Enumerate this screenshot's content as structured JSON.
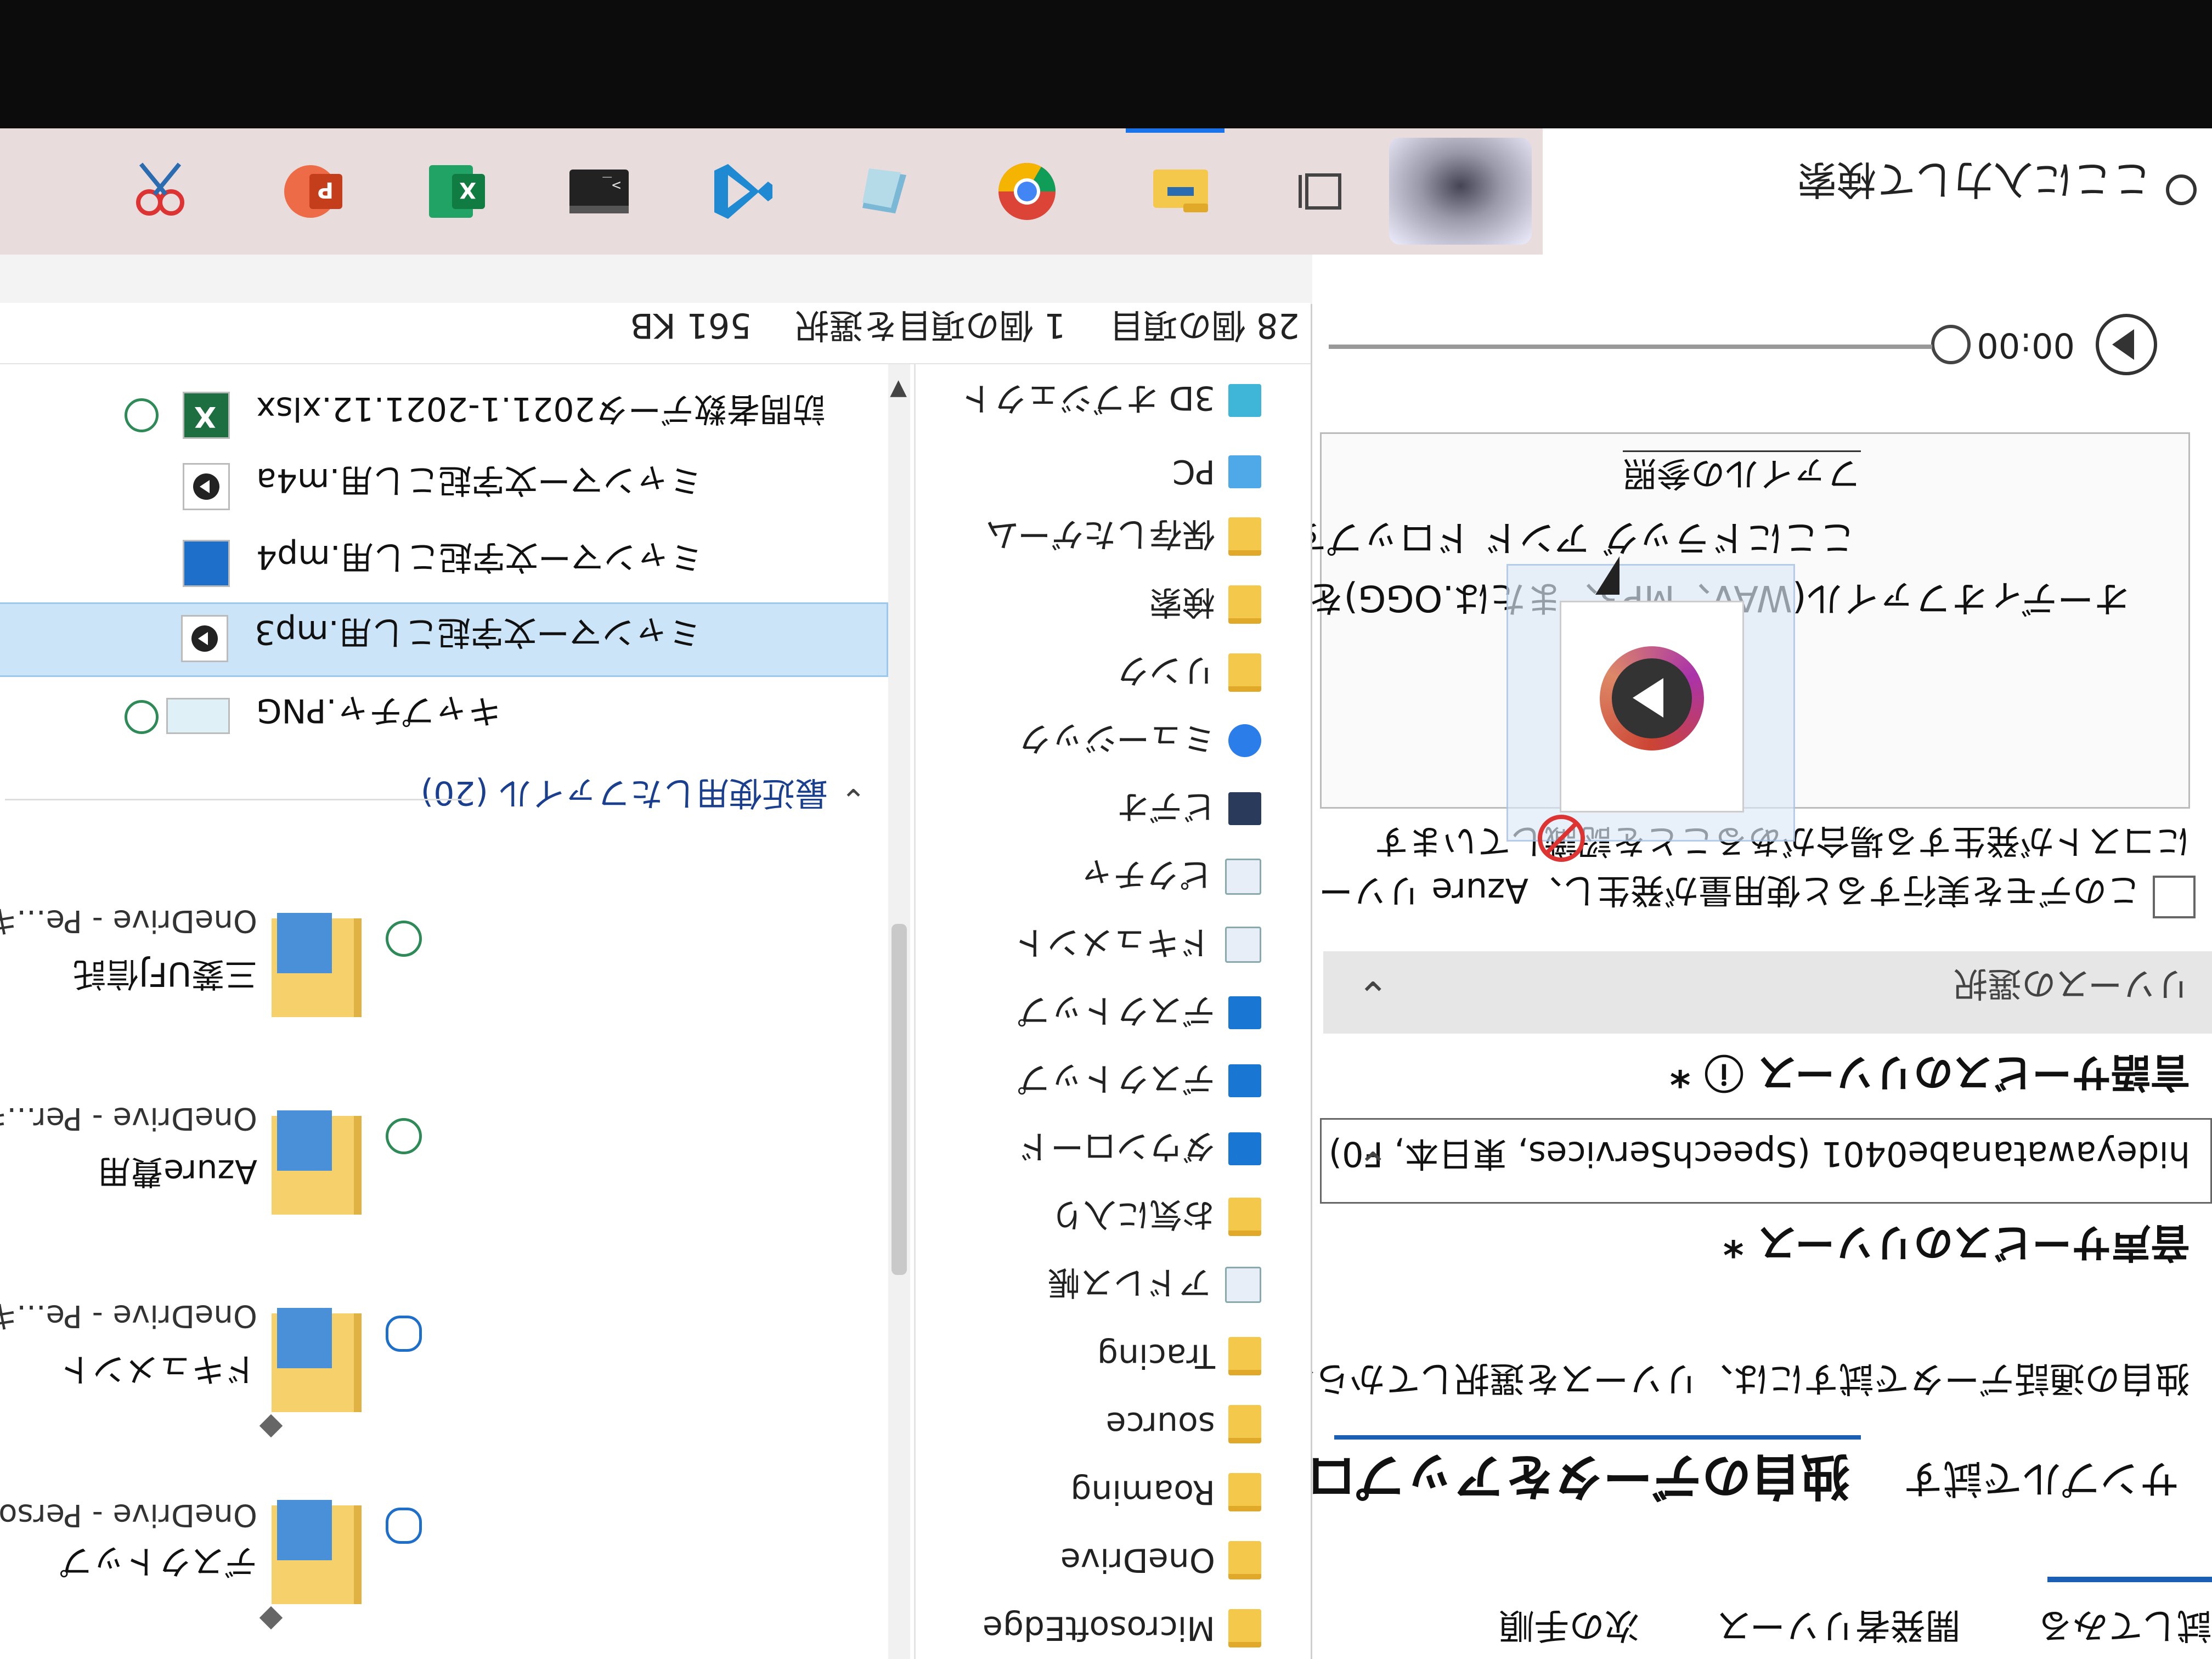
{
  "taskbar": {
    "search_placeholder": "ここに入力して検索",
    "apps": [
      "task-view",
      "file-explorer",
      "chrome",
      "files",
      "vscode",
      "terminal",
      "excel",
      "powerpoint",
      "paint"
    ]
  },
  "webpage": {
    "tabs": [
      "試してみる",
      "開発者リソース",
      "次の手順"
    ],
    "heading": "独自のデータをアップロード",
    "heading_sub": "サンプルで試す",
    "intro": "独自の通話データで試すには、リソースを選択してから、",
    "speech_label": "音声サービスのリソース *",
    "speech_value": "hideyawatanabe0401 (SpeechServices, 東日本, F0)",
    "translator_label": "言語サービスのリソース ⓘ *",
    "resource_placeholder": "リソースの選択",
    "consent_text": "このデモを実行すると使用量が発生し、Azure リソー",
    "consent_text_2": "にコストが発生する場合があることを認識しています",
    "dropzone_line1": "オーディオファイル(WAV、MP3、または.OGG)を",
    "dropzone_line2": "ここにドラッグ アンド ドロップするか、",
    "dropzone_browse": "ファイルの参照",
    "player_time": "00:00"
  },
  "explorer": {
    "status": {
      "item_count": "28 個の項目",
      "selected": "1 個の項目を選択",
      "size": "561 KB"
    },
    "nav_items": [
      {
        "label": "3D オブジェクト",
        "icon": "obj3d"
      },
      {
        "label": "PC",
        "icon": "pc"
      },
      {
        "label": "保存したゲーム",
        "icon": "folder"
      },
      {
        "label": "検索",
        "icon": "folder"
      },
      {
        "label": "リンク",
        "icon": "folder"
      },
      {
        "label": "ミュージック",
        "icon": "music"
      },
      {
        "label": "ビデオ",
        "icon": "video"
      },
      {
        "label": "ピクチャ",
        "icon": "doc"
      },
      {
        "label": "ドキュメント",
        "icon": "doc"
      },
      {
        "label": "デスクトップ",
        "icon": "blue"
      },
      {
        "label": "デスクトップ",
        "icon": "blue"
      },
      {
        "label": "ダウンロード",
        "icon": "blue"
      },
      {
        "label": "お気に入り",
        "icon": "folder"
      },
      {
        "label": "アドレス帳",
        "icon": "doc"
      },
      {
        "label": "Tracing",
        "icon": "folder"
      },
      {
        "label": "source",
        "icon": "folder"
      },
      {
        "label": "Roaming",
        "icon": "folder"
      },
      {
        "label": "OneDrive",
        "icon": "folder"
      },
      {
        "label": "MicrosoftEdge",
        "icon": "folder"
      }
    ],
    "quick_access": [
      {
        "title": "デスクトップ",
        "sub": "OneDrive - Personal"
      },
      {
        "title": "ドキュメント",
        "sub": "OneDrive - Pe...ギスクトップ"
      },
      {
        "title": "Azure費用",
        "sub": "OneDrive - Per...ギ文字起こし"
      },
      {
        "title": "三菱UFJ信託",
        "sub": "OneDrive - Pe...ギスクトップ"
      }
    ],
    "recent_header": "最近使用したファイル (20)",
    "recent_files": [
      {
        "name": "キャプチャ.PNG",
        "type": "png",
        "selected": false
      },
      {
        "name": "ミャンマー文字起こし用.mp3",
        "type": "mp3",
        "selected": true
      },
      {
        "name": "ミャンマー文字起こし用.mp4",
        "type": "mp4",
        "selected": false
      },
      {
        "name": "ミャンマー文字起こし用.m4a",
        "type": "m4a",
        "selected": false
      },
      {
        "name": "訪問者数データ2021.1-2021.12.xlsx",
        "type": "xlsx",
        "selected": false
      }
    ]
  },
  "colors": {
    "accent": "#1a5fb4",
    "selection": "#cce4f7",
    "sync_ok": "#2e8b57",
    "no_drop": "#dd3333"
  }
}
